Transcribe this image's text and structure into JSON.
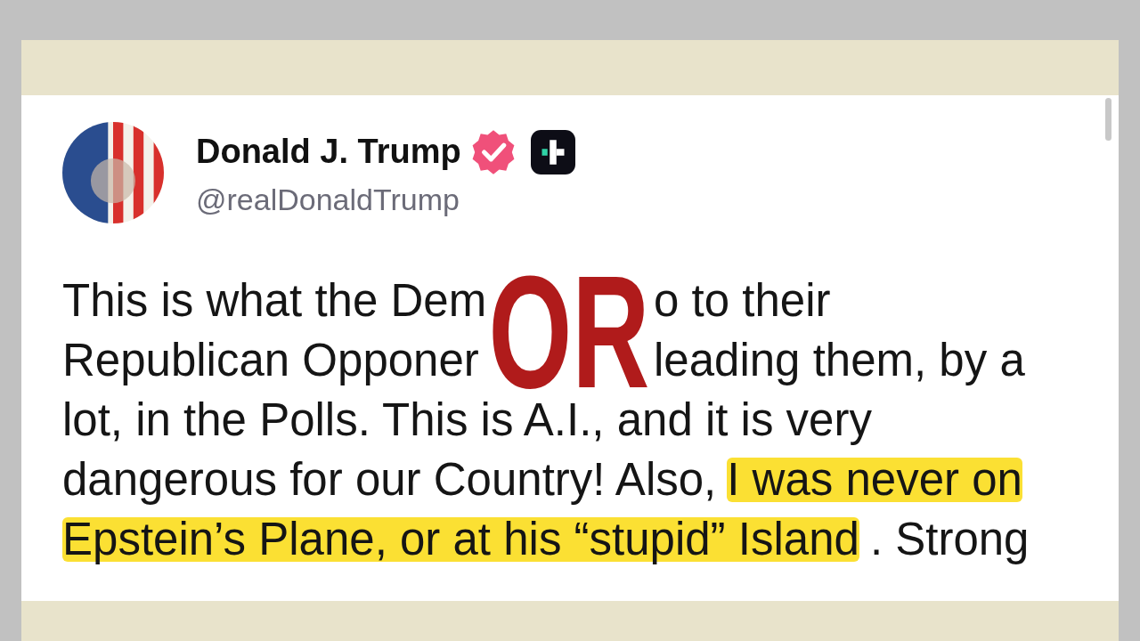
{
  "post": {
    "author": "Donald J. Trump",
    "verified": true,
    "handle": "@realDonaldTrump",
    "lines": [
      {
        "covered": true,
        "parts": [
          {
            "text": "This is what the Dem",
            "highlighted": false
          },
          {
            "text": "o to their",
            "highlighted": false
          }
        ]
      },
      {
        "covered": true,
        "parts": [
          {
            "text": "Republican Opponer",
            "highlighted": false
          },
          {
            "text": "leading them, by a",
            "highlighted": false
          }
        ]
      },
      {
        "parts": [
          {
            "text": "lot, in the Polls. This is A.I., and it is very",
            "highlighted": false
          }
        ]
      },
      {
        "covered": false,
        "parts": [
          {
            "text": "dangerous for our Country! Also,",
            "highlighted": false
          },
          {
            "text": "I was never on",
            "highlighted": true
          }
        ]
      },
      {
        "covered": false,
        "parts": [
          {
            "text": "Epstein’s Plane, or at his “stupid” Island",
            "highlighted": true
          },
          {
            "text": ". Strong",
            "highlighted": false
          }
        ]
      }
    ]
  },
  "overlay": {
    "text": "OR"
  }
}
